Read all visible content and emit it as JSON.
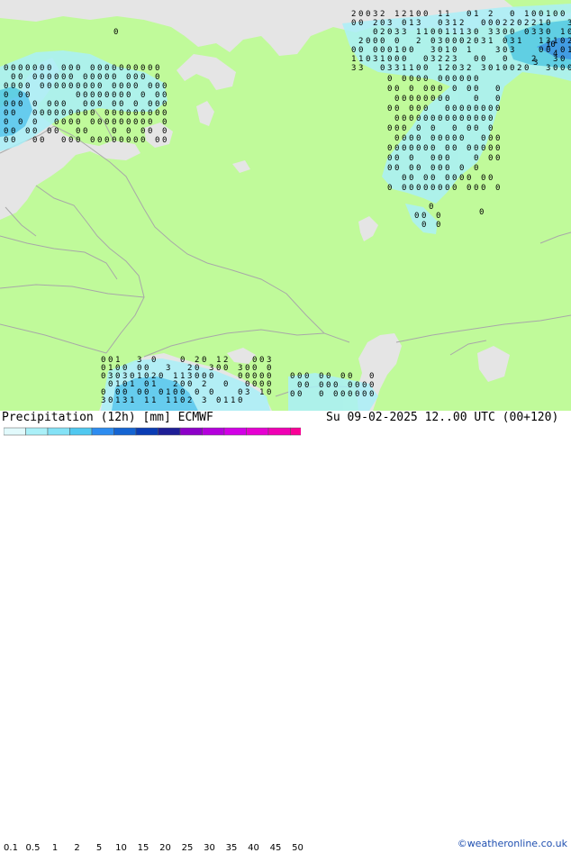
{
  "map": {
    "title": "Precipitation (12h) [mm]",
    "model": "ECMWF",
    "valid_time": "Su 09-02-2025 12..00 UTC (00+120)",
    "credit": "©weatheronline.co.uk",
    "region": "Eastern Europe / Western Russia",
    "colors": {
      "land": "#c0fa9a",
      "sea": "#e5e5e5",
      "border": "#a8a8a8",
      "precip_light": "#aaf0f8",
      "precip_mid": "#50c8f0",
      "precip_heavy": "#2d8cf0"
    },
    "legend": {
      "ticks": [
        "0.1",
        "0.5",
        "1",
        "2",
        "5",
        "10",
        "15",
        "20",
        "25",
        "30",
        "35",
        "40",
        "45",
        "50"
      ],
      "colors": [
        "#e2fafc",
        "#aaf0f8",
        "#84e2f6",
        "#50c8f0",
        "#2d8cf0",
        "#1464d2",
        "#0a3cb4",
        "#1e1e96",
        "#8c00c8",
        "#b400dc",
        "#d200e6",
        "#e600d2",
        "#f000b4",
        "#fa0096"
      ]
    },
    "annotations": [
      {
        "text": "0",
        "size": 10
      },
      {
        "text": "1",
        "size": 10
      },
      {
        "text": "2",
        "size": 10
      },
      {
        "text": "3",
        "size": 10
      },
      {
        "text": "4",
        "size": 10
      },
      {
        "text": "10",
        "size": 10
      }
    ]
  }
}
